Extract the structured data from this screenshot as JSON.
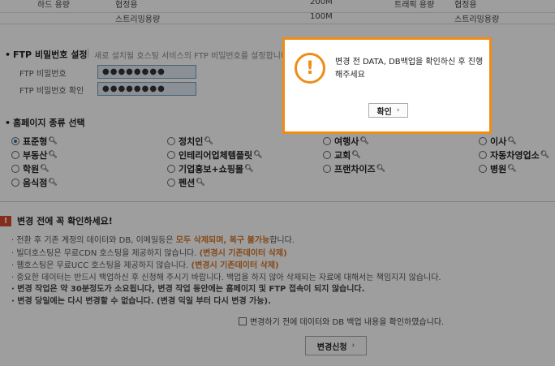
{
  "spec_table": {
    "rows": [
      {
        "left_label": "하드 용량",
        "left_value": "협정용",
        "left_amount": "200M",
        "right_label": "트래픽 용량",
        "right_value": "협정용"
      },
      {
        "left_label": "",
        "left_value": "스트리밍용량",
        "left_amount": "100M",
        "right_label": "",
        "right_value": "스트리밍용량"
      }
    ]
  },
  "ftp": {
    "title": "FTP 비밀번호 설정",
    "hint": "새로 설치될 호스팅 서비스의 FTP 비밀번호를 설정합니다.",
    "password_label": "FTP 비밀번호",
    "password_value": "●●●●●●●●",
    "confirm_label": "FTP 비밀번호 확인",
    "confirm_value": "●●●●●●●●"
  },
  "homepage_type": {
    "title": "홈페이지 종류 선택",
    "options": [
      {
        "label": "표준형",
        "selected": true
      },
      {
        "label": "정치인",
        "selected": false
      },
      {
        "label": "여행사",
        "selected": false
      },
      {
        "label": "이사",
        "selected": false
      },
      {
        "label": "부동산",
        "selected": false
      },
      {
        "label": "인테리어업체템플릿",
        "selected": false
      },
      {
        "label": "교회",
        "selected": false
      },
      {
        "label": "자동차영업소",
        "selected": false
      },
      {
        "label": "학원",
        "selected": false
      },
      {
        "label": "기업홍보+쇼핑몰",
        "selected": false
      },
      {
        "label": "프랜차이즈",
        "selected": false
      },
      {
        "label": "병원",
        "selected": false
      },
      {
        "label": "음식점",
        "selected": false
      },
      {
        "label": "펜션",
        "selected": false
      }
    ]
  },
  "warning": {
    "badge": "!",
    "title": "변경 전에 꼭 확인하세요!",
    "items": [
      {
        "pre": "· 전환 후 기존 계정의 데이터와 DB, 이메일등은 ",
        "hl": "모두 삭제되며, 복구 불가능",
        "post": "합니다."
      },
      {
        "pre": "· 빌더호스팅은 무료CDN 호스팅을 제공하지 않습니다. ",
        "hl": "(변경시 기존데이터 삭제)",
        "post": ""
      },
      {
        "pre": "· 웹호스팅은 무료UCC 호스팅을 제공하지 않습니다. ",
        "hl": "(변경시 기존데이터 삭제)",
        "post": ""
      },
      {
        "pre": "· 중요한 데이터는 반드시 백업하신 후 신청해 주시기 바랍니다. 백업을 하지 않아 삭제되는 자료에 대해서는 책임지지 않습니다.",
        "hl": "",
        "post": ""
      },
      {
        "pre": "· 변경 작업은 약 30분정도가 소요됩니다, 변경 작업 동안에는 홈페이지 및 FTP 접속이 되지 않습니다.",
        "hl": "",
        "post": ""
      },
      {
        "pre": "· 변경 당일에는 다시 변경할 수 없습니다. (변경 익일 부터 다시 변경 가능).",
        "hl": "",
        "post": ""
      }
    ]
  },
  "agree_label": "변경하기 전에 데이터와 DB 백업 내용을 확인하였습니다.",
  "submit_label": "변경신청",
  "dialog": {
    "icon_glyph": "!",
    "message": "변경 전 DATA, DB백업을 확인하신 후 진행해주세요",
    "confirm_label": "확인"
  },
  "colors": {
    "accent_orange": "#f08c14",
    "highlight_orange": "#d6772b",
    "warning_red": "#d6492f"
  }
}
